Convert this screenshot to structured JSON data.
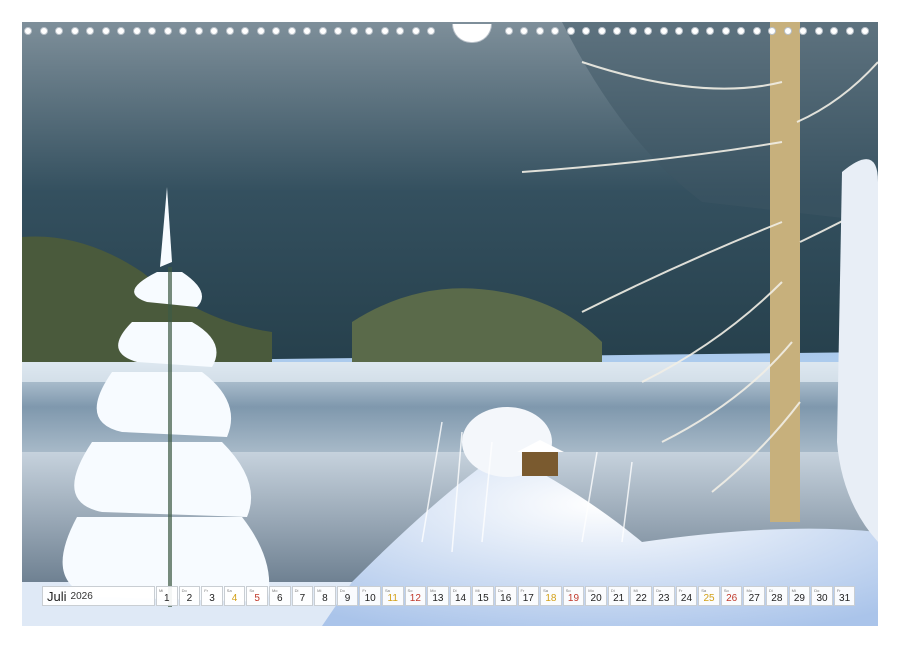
{
  "calendar": {
    "month": "Juli",
    "year": "2026",
    "days": [
      {
        "d": "1",
        "w": "Mi",
        "t": "weekday"
      },
      {
        "d": "2",
        "w": "Do",
        "t": "weekday"
      },
      {
        "d": "3",
        "w": "Fr",
        "t": "weekday"
      },
      {
        "d": "4",
        "w": "Sa",
        "t": "sat"
      },
      {
        "d": "5",
        "w": "So",
        "t": "sun"
      },
      {
        "d": "6",
        "w": "Mo",
        "t": "weekday"
      },
      {
        "d": "7",
        "w": "Di",
        "t": "weekday"
      },
      {
        "d": "8",
        "w": "Mi",
        "t": "weekday"
      },
      {
        "d": "9",
        "w": "Do",
        "t": "weekday"
      },
      {
        "d": "10",
        "w": "Fr",
        "t": "weekday"
      },
      {
        "d": "11",
        "w": "Sa",
        "t": "sat"
      },
      {
        "d": "12",
        "w": "So",
        "t": "sun"
      },
      {
        "d": "13",
        "w": "Mo",
        "t": "weekday"
      },
      {
        "d": "14",
        "w": "Di",
        "t": "weekday"
      },
      {
        "d": "15",
        "w": "Mi",
        "t": "weekday"
      },
      {
        "d": "16",
        "w": "Do",
        "t": "weekday"
      },
      {
        "d": "17",
        "w": "Fr",
        "t": "weekday"
      },
      {
        "d": "18",
        "w": "Sa",
        "t": "sat"
      },
      {
        "d": "19",
        "w": "So",
        "t": "sun"
      },
      {
        "d": "20",
        "w": "Mo",
        "t": "weekday"
      },
      {
        "d": "21",
        "w": "Di",
        "t": "weekday"
      },
      {
        "d": "22",
        "w": "Mi",
        "t": "weekday"
      },
      {
        "d": "23",
        "w": "Do",
        "t": "weekday"
      },
      {
        "d": "24",
        "w": "Fr",
        "t": "weekday"
      },
      {
        "d": "25",
        "w": "Sa",
        "t": "sat"
      },
      {
        "d": "26",
        "w": "So",
        "t": "sun"
      },
      {
        "d": "27",
        "w": "Mo",
        "t": "weekday"
      },
      {
        "d": "28",
        "w": "Di",
        "t": "weekday"
      },
      {
        "d": "29",
        "w": "Mi",
        "t": "weekday"
      },
      {
        "d": "30",
        "w": "Do",
        "t": "weekday"
      },
      {
        "d": "31",
        "w": "Fr",
        "t": "weekday"
      }
    ]
  },
  "colors": {
    "sky": "#8fb8e6",
    "forest": "#2f4552",
    "snow": "#f4f8fc",
    "water": "#9fb3c4",
    "saturday": "#d3a018",
    "sunday": "#c0392b"
  }
}
